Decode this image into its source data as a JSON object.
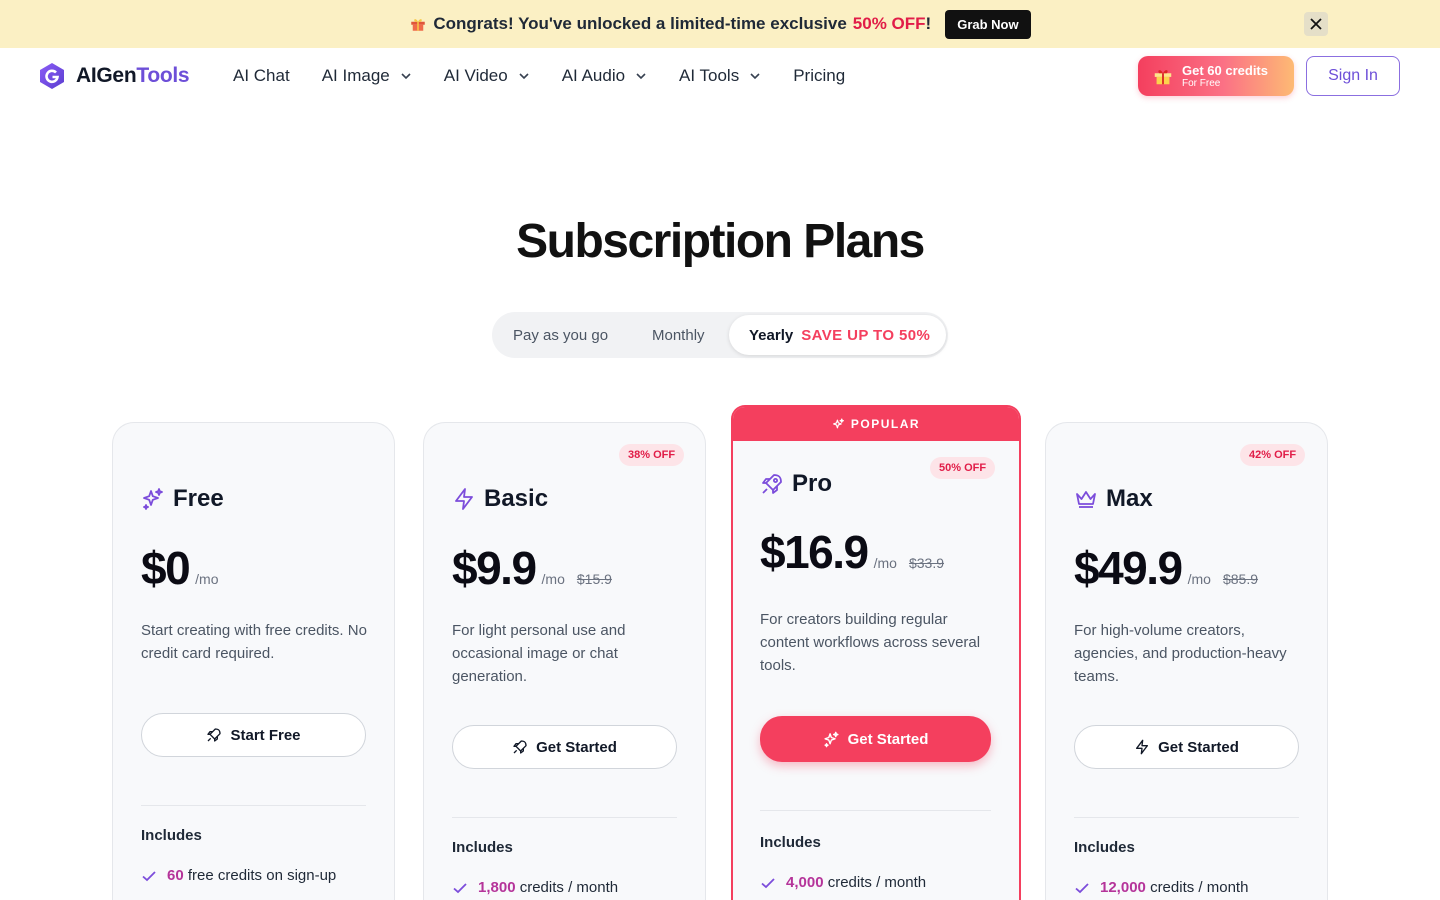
{
  "promo": {
    "text_before": "Congrats! You've unlocked a limited-time exclusive",
    "highlight": "50% OFF",
    "text_after": "!",
    "button": "Grab Now"
  },
  "nav": {
    "logo_part1": "AIGen",
    "logo_part2": "Tools",
    "items": [
      {
        "label": "AI Chat"
      },
      {
        "label": "AI Image"
      },
      {
        "label": "AI Video"
      },
      {
        "label": "AI Audio"
      },
      {
        "label": "AI Tools"
      },
      {
        "label": "Pricing"
      }
    ],
    "credits_main": "Get 60 credits",
    "credits_sub": "For Free",
    "signin": "Sign In"
  },
  "page": {
    "title": "Subscription Plans"
  },
  "billing": {
    "payg": "Pay as you go",
    "monthly": "Monthly",
    "yearly": "Yearly",
    "save": "SAVE UP TO 50%"
  },
  "plans": [
    {
      "name": "Free",
      "price": "$0",
      "per": "/mo",
      "description": "Start creating with free credits. No credit card required.",
      "cta": "Start Free",
      "includes": "Includes",
      "feature_num": "60",
      "feature_text": "free credits on sign-up"
    },
    {
      "name": "Basic",
      "discount": "38% OFF",
      "price": "$9.9",
      "per": "/mo",
      "old_price": "$15.9",
      "description": "For light personal use and occasional image or chat generation.",
      "cta": "Get Started",
      "includes": "Includes",
      "feature_num": "1,800",
      "feature_text": "credits / month"
    },
    {
      "name": "Pro",
      "badge": "POPULAR",
      "discount": "50% OFF",
      "price": "$16.9",
      "per": "/mo",
      "old_price": "$33.9",
      "description": "For creators building regular content workflows across several tools.",
      "cta": "Get Started",
      "includes": "Includes",
      "feature_num": "4,000",
      "feature_text": "credits / month"
    },
    {
      "name": "Max",
      "discount": "42% OFF",
      "price": "$49.9",
      "per": "/mo",
      "old_price": "$85.9",
      "description": "For high-volume creators, agencies, and production-heavy teams.",
      "cta": "Get Started",
      "includes": "Includes",
      "feature_num": "12,000",
      "feature_text": "credits / month"
    }
  ],
  "colors": {
    "accent_pink": "#f43f5e",
    "brand_purple": "#6d4fd8",
    "feature_number": "#b5349a"
  }
}
